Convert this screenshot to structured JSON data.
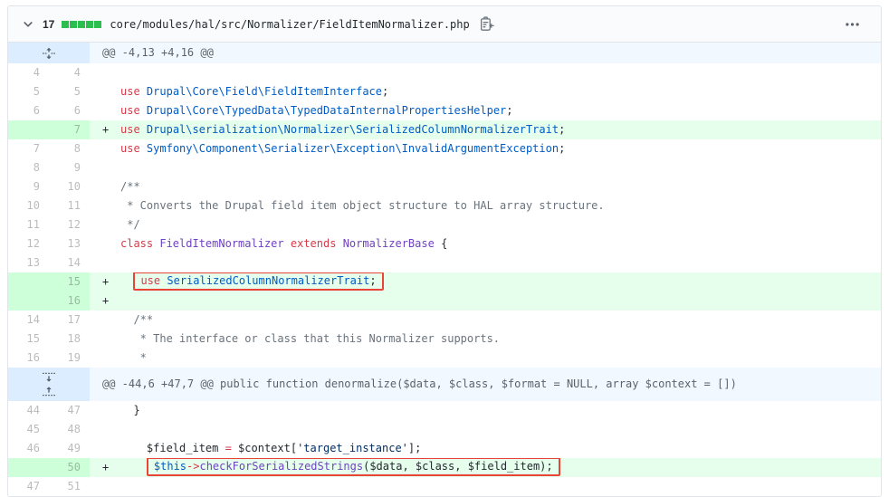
{
  "file": {
    "changes_count": "17",
    "diffstat_squares": [
      "added",
      "added",
      "added",
      "added",
      "added"
    ],
    "path": "core/modules/hal/src/Normalizer/FieldItemNormalizer.php",
    "icons": {
      "collapse": "chevron-down",
      "copy_path": "clipboard-arrow",
      "menu": "kebab-horizontal"
    }
  },
  "colors": {
    "diffstat_green": "#2cbe4e",
    "addition_bg": "#e6ffed",
    "addition_gutter_bg": "#cdffd8",
    "hunk_bg": "#f1f8ff",
    "hunk_gutter_bg": "#dbedff",
    "annotation_red": "#ea4436",
    "keyword_red": "#d73a49",
    "constant_blue": "#005cc5",
    "entity_purple": "#6f42c1",
    "string_navy": "#032f62",
    "comment_gray": "#6a737d"
  },
  "diff": {
    "rows": [
      {
        "type": "hunk",
        "expanders": [
          "unfold"
        ],
        "text": "@@ -4,13 +4,16 @@"
      },
      {
        "type": "context",
        "old": "4",
        "new": "4",
        "sign": "",
        "tokens": []
      },
      {
        "type": "context",
        "old": "5",
        "new": "5",
        "sign": "",
        "tokens": [
          [
            "k",
            "use"
          ],
          [
            "p",
            " "
          ],
          [
            "n",
            "Drupal\\Core\\Field\\FieldItemInterface"
          ],
          [
            "p",
            ";"
          ]
        ]
      },
      {
        "type": "context",
        "old": "6",
        "new": "6",
        "sign": "",
        "tokens": [
          [
            "k",
            "use"
          ],
          [
            "p",
            " "
          ],
          [
            "n",
            "Drupal\\Core\\TypedData\\TypedDataInternalPropertiesHelper"
          ],
          [
            "p",
            ";"
          ]
        ]
      },
      {
        "type": "add",
        "old": "",
        "new": "7",
        "sign": "+",
        "tokens": [
          [
            "k",
            "use"
          ],
          [
            "p",
            " "
          ],
          [
            "n",
            "Drupal\\serialization\\Normalizer\\SerializedColumnNormalizerTrait"
          ],
          [
            "p",
            ";"
          ]
        ]
      },
      {
        "type": "context",
        "old": "7",
        "new": "8",
        "sign": "",
        "tokens": [
          [
            "k",
            "use"
          ],
          [
            "p",
            " "
          ],
          [
            "n",
            "Symfony\\Component\\Serializer\\Exception\\InvalidArgumentException"
          ],
          [
            "p",
            ";"
          ]
        ]
      },
      {
        "type": "context",
        "old": "8",
        "new": "9",
        "sign": "",
        "tokens": []
      },
      {
        "type": "context",
        "old": "9",
        "new": "10",
        "sign": "",
        "tokens": [
          [
            "c",
            "/**"
          ]
        ]
      },
      {
        "type": "context",
        "old": "10",
        "new": "11",
        "sign": "",
        "tokens": [
          [
            "c",
            " * Converts the Drupal field item object structure to HAL array structure."
          ]
        ]
      },
      {
        "type": "context",
        "old": "11",
        "new": "12",
        "sign": "",
        "tokens": [
          [
            "c",
            " */"
          ]
        ]
      },
      {
        "type": "context",
        "old": "12",
        "new": "13",
        "sign": "",
        "tokens": [
          [
            "k",
            "class"
          ],
          [
            "p",
            " "
          ],
          [
            "e",
            "FieldItemNormalizer"
          ],
          [
            "p",
            " "
          ],
          [
            "k",
            "extends"
          ],
          [
            "p",
            " "
          ],
          [
            "e",
            "NormalizerBase"
          ],
          [
            "p",
            " {"
          ]
        ]
      },
      {
        "type": "context",
        "old": "13",
        "new": "14",
        "sign": "",
        "tokens": []
      },
      {
        "type": "add",
        "old": "",
        "new": "15",
        "sign": "+",
        "indent": "  ",
        "boxed": true,
        "tokens": [
          [
            "k",
            "use"
          ],
          [
            "p",
            " "
          ],
          [
            "n",
            "SerializedColumnNormalizerTrait"
          ],
          [
            "p",
            ";"
          ]
        ]
      },
      {
        "type": "add",
        "old": "",
        "new": "16",
        "sign": "+",
        "tokens": []
      },
      {
        "type": "context",
        "old": "14",
        "new": "17",
        "sign": "",
        "tokens": [
          [
            "c",
            "  /**"
          ]
        ]
      },
      {
        "type": "context",
        "old": "15",
        "new": "18",
        "sign": "",
        "tokens": [
          [
            "c",
            "   * The interface or class that this Normalizer supports."
          ]
        ]
      },
      {
        "type": "context",
        "old": "16",
        "new": "19",
        "sign": "",
        "tokens": [
          [
            "c",
            "   *"
          ]
        ]
      },
      {
        "type": "hunk",
        "expanders": [
          "fold-down",
          "fold-up"
        ],
        "text": "@@ -44,6 +47,7 @@ public function denormalize($data, $class, $format = NULL, array $context = [])"
      },
      {
        "type": "context",
        "old": "44",
        "new": "47",
        "sign": "",
        "tokens": [
          [
            "p",
            "  }"
          ]
        ]
      },
      {
        "type": "context",
        "old": "45",
        "new": "48",
        "sign": "",
        "tokens": []
      },
      {
        "type": "context",
        "old": "46",
        "new": "49",
        "sign": "",
        "tokens": [
          [
            "p",
            "    $field_item "
          ],
          [
            "k",
            "="
          ],
          [
            "p",
            " $context["
          ],
          [
            "s",
            "'target_instance'"
          ],
          [
            "p",
            "];"
          ]
        ]
      },
      {
        "type": "add",
        "old": "",
        "new": "50",
        "sign": "+",
        "indent": "    ",
        "boxed": true,
        "tokens": [
          [
            "n",
            "$this"
          ],
          [
            "k",
            "->"
          ],
          [
            "e",
            "checkForSerializedStrings"
          ],
          [
            "p",
            "($data, $class, $field_item);"
          ]
        ]
      },
      {
        "type": "context",
        "old": "47",
        "new": "51",
        "sign": "",
        "tokens": []
      }
    ]
  }
}
